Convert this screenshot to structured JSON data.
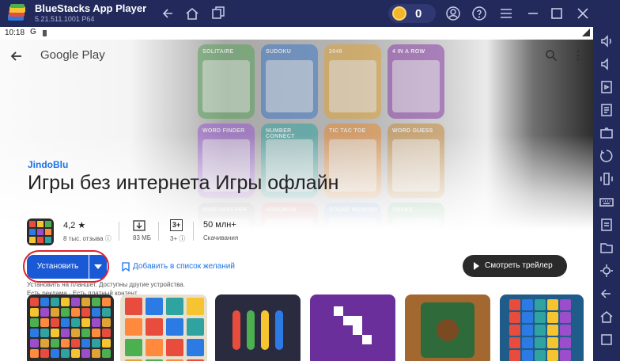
{
  "titlebar": {
    "app_name": "BlueStacks App Player",
    "version": "5.21.511.1001 P64",
    "coins": "0",
    "icons": [
      "back-icon",
      "home-icon",
      "multi-instance-icon",
      "account-icon",
      "help-icon",
      "menu-icon",
      "minimize-icon",
      "maximize-icon",
      "close-icon"
    ]
  },
  "statusbar": {
    "time": "10:18",
    "g_label": "G"
  },
  "playstore": {
    "logo_text": "Google Play",
    "developer": "JindoBlu",
    "title": "Игры без интернета Игры офлайн",
    "stats": [
      {
        "value": "4,2 ★",
        "label": "8 тыс. отзыва ⓘ"
      },
      {
        "value": "83 МБ",
        "label": "83 МБ"
      },
      {
        "value": "3+",
        "label": "3+ ⓘ"
      },
      {
        "value": "50 млн+",
        "label": "Скачивания"
      }
    ],
    "install_label": "Установить",
    "wishlist_label": "Добавить в список желаний",
    "info_line1": "Установить на планшет. Доступны другие устройства.",
    "info_line2": "Есть реклама · Есть платный контент",
    "trailer_label": "Смотреть трейлер"
  },
  "feature_cards": [
    {
      "label": "SOLITAIRE",
      "color": "#5aa35a"
    },
    {
      "label": "SUDOKU",
      "color": "#3f78c8"
    },
    {
      "label": "2048",
      "color": "#e0a335"
    },
    {
      "label": "4 IN A ROW",
      "color": "#8b3fa8"
    },
    {
      "label": "WORD FINDER",
      "color": "#9a5ad0"
    },
    {
      "label": "NUMBER CONNECT",
      "color": "#2fa3a0"
    },
    {
      "label": "TIC TAC TOE",
      "color": "#e88a30"
    },
    {
      "label": "WORD GUESS",
      "color": "#c78b3a"
    },
    {
      "label": "MINESWEEPER",
      "color": "#7a7a7a"
    },
    {
      "label": "HANGMAN",
      "color": "#d45a5a"
    },
    {
      "label": "SOUND MEMORY",
      "color": "#5a8ad0"
    },
    {
      "label": "SNAKE",
      "color": "#3fa35a"
    }
  ],
  "screenshot_colors": [
    "#2b2b2b",
    "#e8e0cf",
    "#2b2b40",
    "#6a2f9a",
    "#a2682f",
    "#1f5c8a"
  ],
  "sidebar_icons": [
    "volume-up-icon",
    "volume-down-icon",
    "media-manager-icon",
    "install-apk-icon",
    "screenshot-icon",
    "rotate-icon",
    "shake-icon",
    "keyboard-controls-icon",
    "apk-icon",
    "folder-icon",
    "settings-icon",
    "back-nav-icon",
    "home-nav-icon",
    "recents-nav-icon"
  ]
}
